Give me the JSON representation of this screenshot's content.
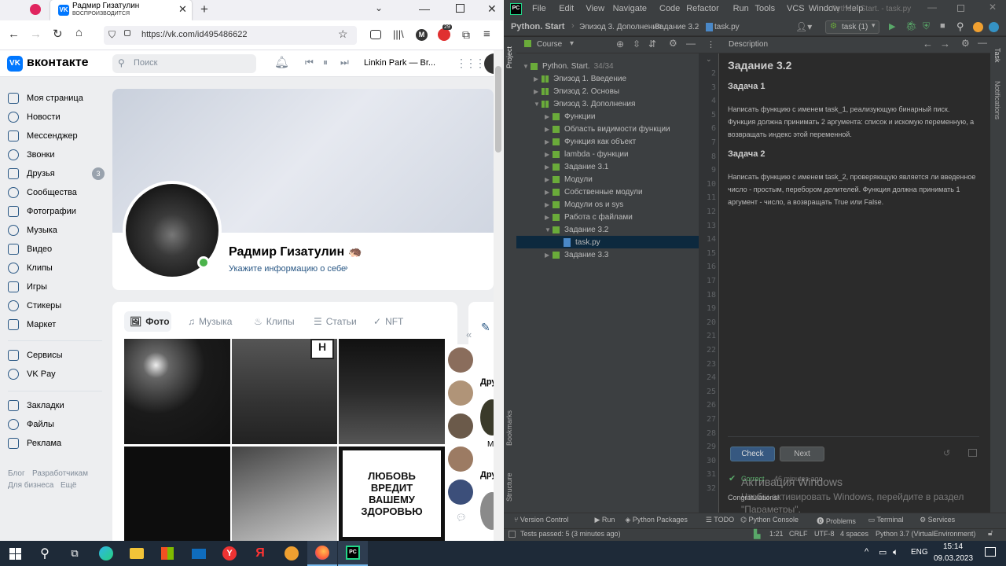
{
  "firefox": {
    "tab": {
      "title": "Радмир Гизатулин",
      "subtitle": "ВОСПРОИЗВОДИТСЯ"
    },
    "url": "https://vk.com/id495486622",
    "ext_badge": "29"
  },
  "vk": {
    "logo_text": "вконтакте",
    "search_placeholder": "Поиск",
    "player_track": "Linkin Park — Br...",
    "sidebar": [
      {
        "label": "Моя страница"
      },
      {
        "label": "Новости"
      },
      {
        "label": "Мессенджер"
      },
      {
        "label": "Звонки"
      },
      {
        "label": "Друзья",
        "badge": "3"
      },
      {
        "label": "Сообщества"
      },
      {
        "label": "Фотографии"
      },
      {
        "label": "Музыка"
      },
      {
        "label": "Видео"
      },
      {
        "label": "Клипы"
      },
      {
        "label": "Игры"
      },
      {
        "label": "Стикеры"
      },
      {
        "label": "Маркет"
      }
    ],
    "sidebar2": [
      {
        "label": "Сервисы"
      },
      {
        "label": "VK Pay"
      }
    ],
    "sidebar3": [
      {
        "label": "Закладки"
      },
      {
        "label": "Файлы"
      },
      {
        "label": "Реклама"
      }
    ],
    "footer": {
      "blog": "Блог",
      "devs": "Разработчикам",
      "biz": "Для бизнеса",
      "more": "Ещё"
    },
    "profile": {
      "name": "Радмир Гизатулин",
      "emoji": "🦔",
      "info_link": "Укажите информацию о себе"
    },
    "media_tabs": [
      "Фото",
      "Музыка",
      "Клипы",
      "Статьи",
      "NFT"
    ],
    "poster": "ЛЮБОВЬ ВРЕДИТ ВАШЕМУ ЗДОРОВЬЮ",
    "side_labels": [
      "Дру",
      "М",
      "Дру"
    ]
  },
  "pycharm": {
    "menu": [
      "File",
      "Edit",
      "View",
      "Navigate",
      "Code",
      "Refactor",
      "Run",
      "Tools",
      "VCS",
      "Window",
      "Help"
    ],
    "window_title": "Python. Start. - task.py",
    "breadcrumbs": [
      "Python. Start",
      "Эпизод 3. Дополнения",
      "Задание 3.2",
      "task.py"
    ],
    "run_config": "task (1)",
    "project_panel": {
      "title": "Course"
    },
    "tree": [
      {
        "label": "Python. Start.",
        "extra": "34/34",
        "level": 0,
        "open": true
      },
      {
        "label": "Эпизод 1. Введение",
        "level": 1,
        "grid": true
      },
      {
        "label": "Эпизод 2. Основы",
        "level": 1,
        "grid": true
      },
      {
        "label": "Эпизод 3. Дополнения",
        "level": 1,
        "grid": true,
        "open": true
      },
      {
        "label": "Функции",
        "level": 2
      },
      {
        "label": "Область видимости функции",
        "level": 2
      },
      {
        "label": "Функция как объект",
        "level": 2
      },
      {
        "label": "lambda - функции",
        "level": 2
      },
      {
        "label": "Задание 3.1",
        "level": 2
      },
      {
        "label": "Модули",
        "level": 2
      },
      {
        "label": "Собственные модули",
        "level": 2
      },
      {
        "label": "Модули os и sys",
        "level": 2
      },
      {
        "label": "Работа с файлами",
        "level": 2
      },
      {
        "label": "Задание 3.2",
        "level": 2,
        "open": true
      },
      {
        "label": "task.py",
        "level": 3,
        "file": true,
        "selected": true
      },
      {
        "label": "Задание 3.3",
        "level": 2
      }
    ],
    "line_numbers": [
      "2",
      "3",
      "4",
      "5",
      "6",
      "7",
      "8",
      "9",
      "10",
      "11",
      "12",
      "13",
      "14",
      "15",
      "16",
      "17",
      "18",
      "19",
      "20",
      "21",
      "22",
      "23",
      "24",
      "25",
      "26",
      "27",
      "28",
      "29",
      "30",
      "31",
      "32"
    ],
    "description": {
      "tab": "Description",
      "title": "Задание 3.2",
      "task1_title": "Задача 1",
      "task1_text": "Написать функцию с именем task_1, реализующую бинарный писк. Функция должна принимать 2 аргумента: список и искомую переменную, а возвращать индекс этой переменной.",
      "task2_title": "Задача 2",
      "task2_text": "Написать функцию с именем task_2, проверяющую является ли введенное число - простым, перебором делителей. Функция должна принимать 1 аргумент - число, а возвращать True или False.",
      "check": "Check",
      "next": "Next",
      "result": "Correct",
      "result_time": "46 minutes ago",
      "congrats": "Congratulations!"
    },
    "left_strip": [
      "Project",
      "Bookmarks",
      "Structure"
    ],
    "right_strip": [
      "Task",
      "Notifications"
    ],
    "bottom_tabs": [
      "Version Control",
      "Run",
      "Python Packages",
      "TODO",
      "Python Console",
      "Problems",
      "Terminal",
      "Services"
    ],
    "status": {
      "tests": "Tests passed: 5 (3 minutes ago)",
      "pos": "1:21",
      "crlf": "CRLF",
      "enc": "UTF-8",
      "indent": "4 spaces",
      "interp": "Python 3.7 (VirtualEnvironment)"
    },
    "watermark": {
      "title": "Активация Windows",
      "text": "Чтобы активировать Windows, перейдите в раздел \"Параметры\"."
    }
  },
  "taskbar": {
    "lang": "ENG",
    "time": "15:14",
    "date": "09.03.2023"
  },
  "colors": {
    "vk_blue": "#0077ff",
    "pc_green": "#6aab3a",
    "pc_bg": "#2b2b2b"
  }
}
